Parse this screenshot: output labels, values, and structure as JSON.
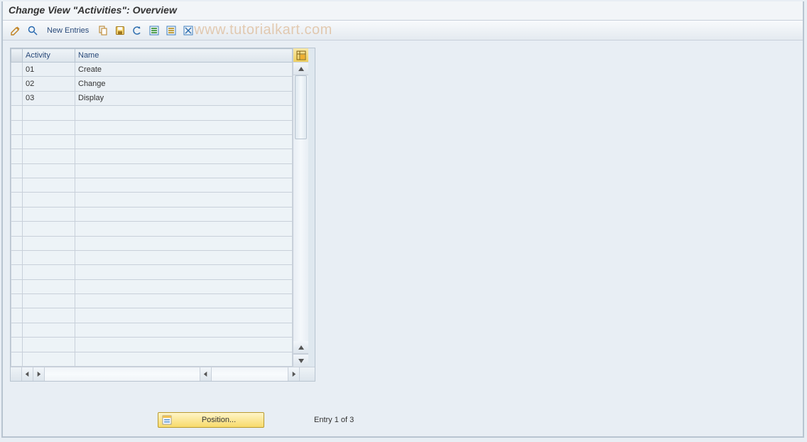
{
  "title": "Change View \"Activities\": Overview",
  "toolbar": {
    "new_entries_label": "New Entries"
  },
  "watermark": "www.tutorialkart.com",
  "table": {
    "headers": {
      "activity": "Activity",
      "name": "Name"
    },
    "rows": [
      {
        "activity": "01",
        "name": "Create"
      },
      {
        "activity": "02",
        "name": "Change"
      },
      {
        "activity": "03",
        "name": "Display"
      }
    ],
    "empty_rows": 18
  },
  "footer": {
    "position_label": "Position...",
    "entry_text": "Entry 1 of 3"
  }
}
